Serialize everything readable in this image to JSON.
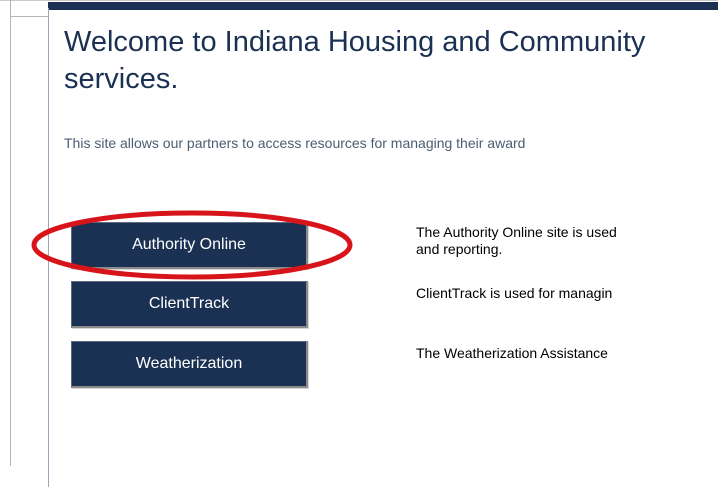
{
  "page": {
    "title_line1": "Welcome to Indiana Housing and Community",
    "title_line2": "services.",
    "intro": "This site allows our partners to access resources for managing their award"
  },
  "buttons": [
    {
      "label": "Authority Online",
      "description_line1": "The Authority Online site is used",
      "description_line2": "and reporting."
    },
    {
      "label": "ClientTrack",
      "description_line1": "ClientTrack is used for managin"
    },
    {
      "label": "Weatherization",
      "description_line1": "The Weatherization Assistance"
    }
  ],
  "colors": {
    "brand_navy": "#1b3154",
    "highlight_red": "#d8141b",
    "intro_text": "#4b5d73"
  },
  "annotations": {
    "highlighted_button": "Authority Online"
  }
}
